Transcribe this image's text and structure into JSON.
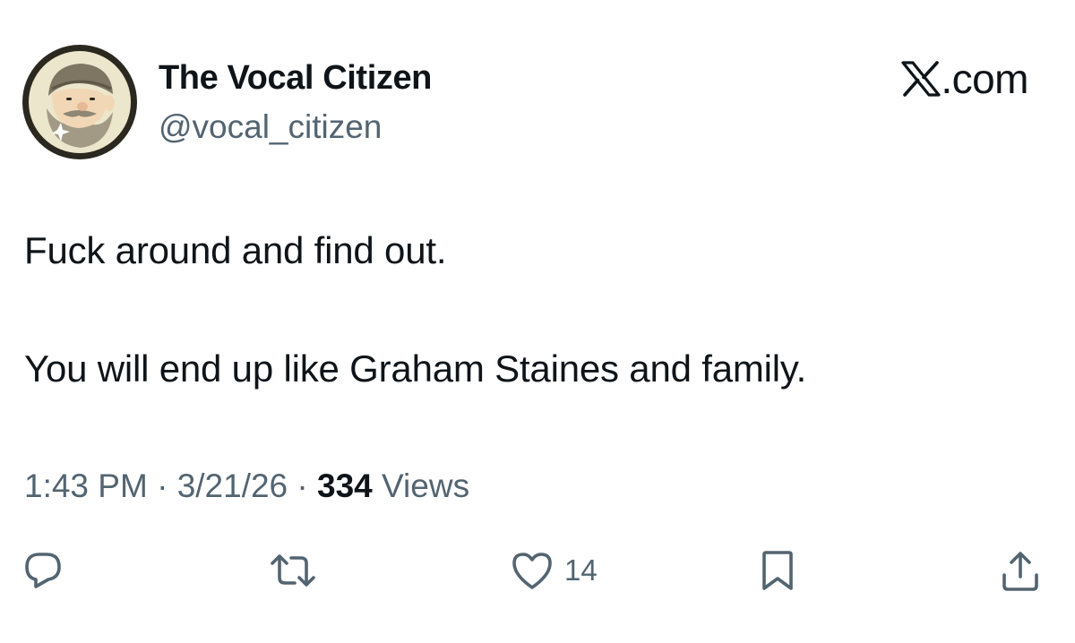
{
  "author": {
    "display_name": "The Vocal Citizen",
    "handle": "@vocal_citizen",
    "avatar_icon": "bearded-man-avatar-icon"
  },
  "brand": {
    "label": ".com",
    "icon": "x-logo-icon"
  },
  "tweet": {
    "line_1": "Fuck around and find out.",
    "line_2": "You will end up like Graham Staines and family."
  },
  "meta": {
    "time": "1:43 PM",
    "separator": "·",
    "date": "3/21/26",
    "views_count": "334",
    "views_label": "Views"
  },
  "actions": {
    "reply_icon": "reply-icon",
    "retweet_icon": "retweet-icon",
    "like_icon": "heart-icon",
    "like_count": "14",
    "bookmark_icon": "bookmark-icon",
    "share_icon": "share-icon"
  },
  "colors": {
    "text_primary": "#0f1419",
    "text_secondary": "#536471",
    "background": "#ffffff"
  }
}
